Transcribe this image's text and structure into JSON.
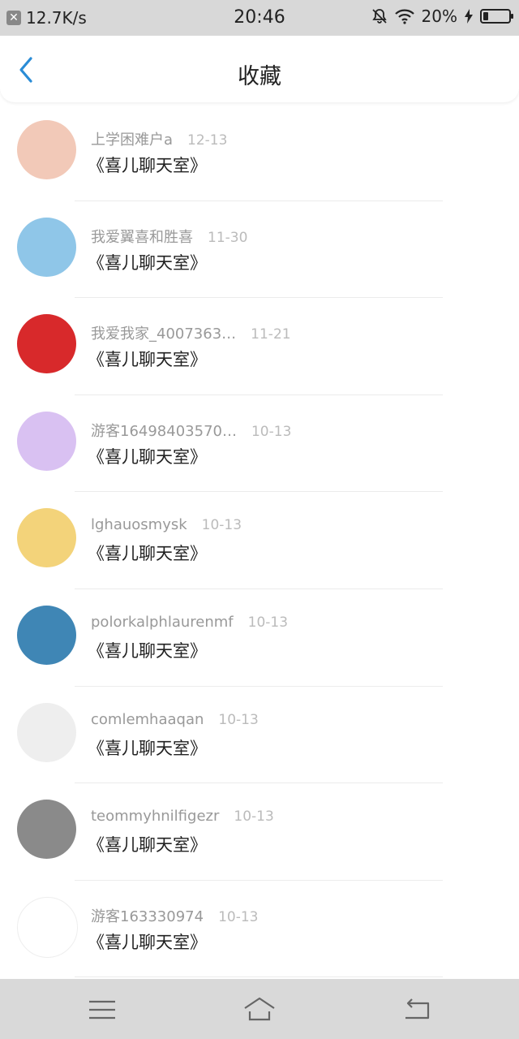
{
  "status_bar": {
    "speed": "12.7K/s",
    "time": "20:46",
    "battery": "20%",
    "battery_level": 0.2
  },
  "header": {
    "title": "收藏"
  },
  "items": [
    {
      "user": "上学困难户a",
      "time": "12-13",
      "content": "《喜儿聊天室》",
      "avatar_color": "#f2c9b8"
    },
    {
      "user": "我爱翼喜和胜喜",
      "time": "11-30",
      "content": "《喜儿聊天室》",
      "avatar_color": "#8fc6e8"
    },
    {
      "user": "我爱我家_4007363…",
      "time": "11-21",
      "content": "《喜儿聊天室》",
      "avatar_color": "#d8292b"
    },
    {
      "user": "游客16498403570…",
      "time": "10-13",
      "content": "《喜儿聊天室》",
      "avatar_color": "#d9c1f2"
    },
    {
      "user": "lghauosmysk",
      "time": "10-13",
      "content": "《喜儿聊天室》",
      "avatar_color": "#f3d37a"
    },
    {
      "user": "polorkalphlaurenmf",
      "time": "10-13",
      "content": "《喜儿聊天室》",
      "avatar_color": "#3f86b5"
    },
    {
      "user": "comlemhaaqan",
      "time": "10-13",
      "content": "《喜儿聊天室》",
      "avatar_color": "#eeeeee"
    },
    {
      "user": "teommyhnilfigezr",
      "time": "10-13",
      "content": "《喜儿聊天室》",
      "avatar_color": "#8a8a8a"
    },
    {
      "user": "游客163330974",
      "time": "10-13",
      "content": "《喜儿聊天室》",
      "avatar_color": "#ffffff"
    }
  ]
}
